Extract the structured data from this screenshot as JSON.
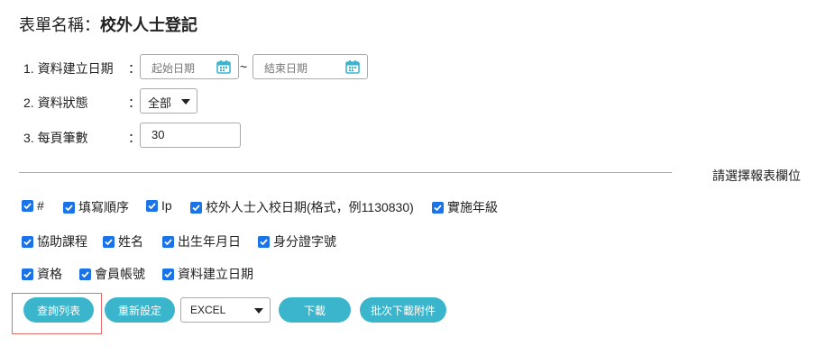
{
  "header": {
    "prefix": "表單名稱：",
    "form_name": "校外人士登記"
  },
  "filters": {
    "date_label": "1.  資料建立日期",
    "status_label": "2.  資料狀態",
    "per_page_label": "3.  每頁筆數",
    "colon": "：",
    "start_placeholder": "起始日期",
    "end_placeholder": "結束日期",
    "tilde": "~",
    "status_value": "全部",
    "per_page_value": "30"
  },
  "fields_label": "請選擇報表欄位",
  "checkboxes": [
    {
      "label": "#",
      "checked": true
    },
    {
      "label": "填寫順序",
      "checked": true
    },
    {
      "label": "Ip",
      "checked": true
    },
    {
      "label": "校外人士入校日期(格式，例1130830)",
      "checked": true
    },
    {
      "label": "實施年級",
      "checked": true
    },
    {
      "label": "協助課程",
      "checked": true
    },
    {
      "label": "姓名",
      "checked": true
    },
    {
      "label": "出生年月日",
      "checked": true
    },
    {
      "label": "身分證字號",
      "checked": true
    },
    {
      "label": "資格",
      "checked": true
    },
    {
      "label": "會員帳號",
      "checked": true
    },
    {
      "label": "資料建立日期",
      "checked": true
    }
  ],
  "actions": {
    "query": "查詢列表",
    "reset": "重新設定",
    "format": "EXCEL",
    "download": "下載",
    "batch_download": "批次下載附件"
  },
  "colors": {
    "accent": "#3bb5cc",
    "checkbox": "#1a73e8",
    "highlight": "#e06b6b"
  }
}
